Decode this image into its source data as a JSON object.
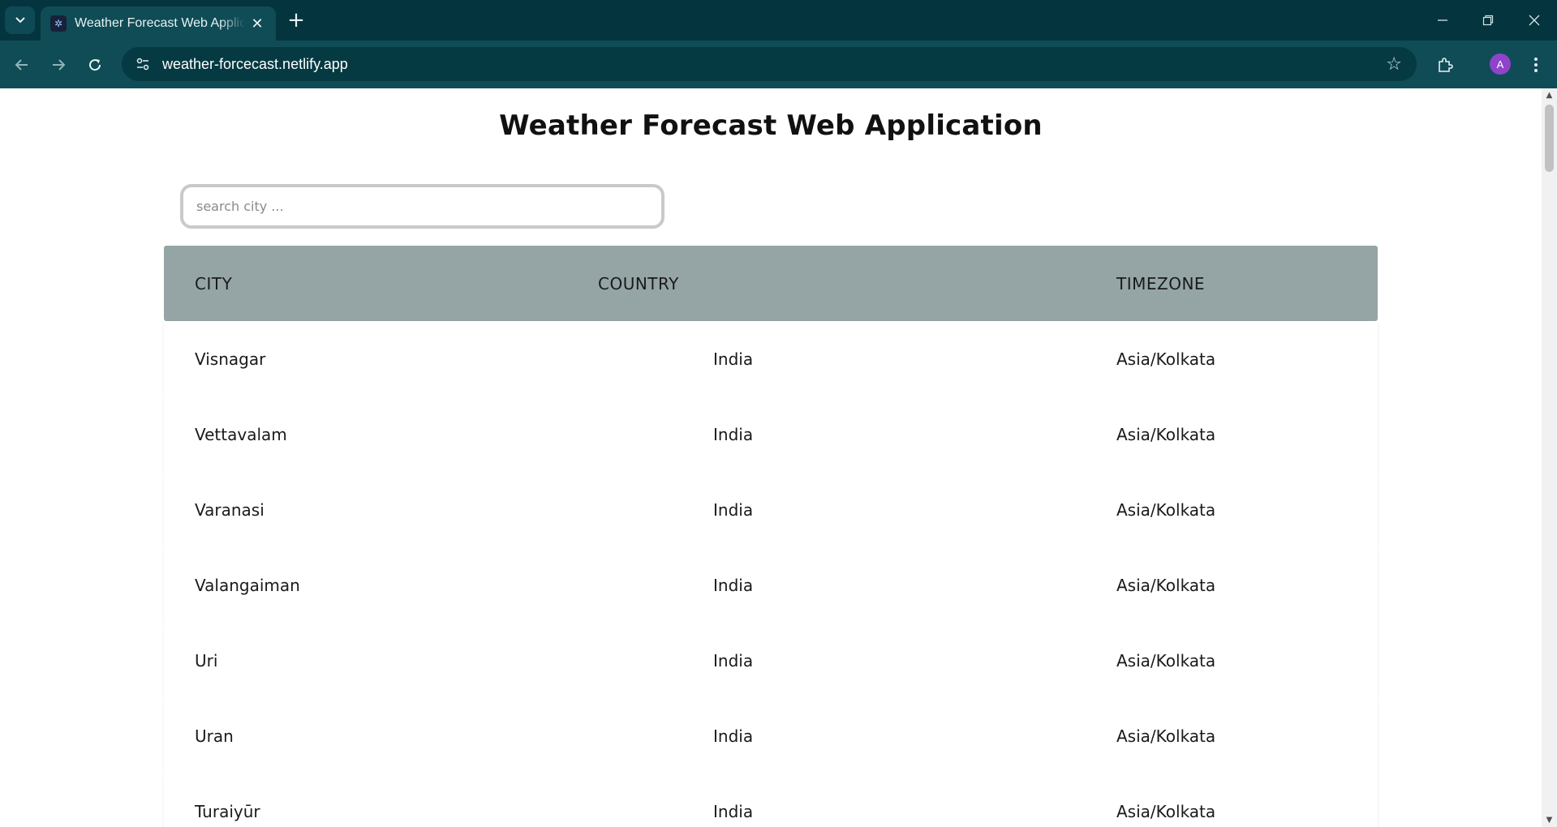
{
  "browser": {
    "tab_title": "Weather Forecast Web Application",
    "url": "weather-forcecast.netlify.app",
    "profile_initial": "A",
    "accent_color": "#04343d"
  },
  "page": {
    "title": "Weather Forecast Web Application",
    "search_placeholder": "search city ..."
  },
  "table": {
    "headers": {
      "city": "CITY",
      "country": "COUNTRY",
      "timezone": "TIMEZONE"
    },
    "header_color": "#95a5a6",
    "rows": [
      {
        "city": "Visnagar",
        "country": "India",
        "timezone": "Asia/Kolkata"
      },
      {
        "city": "Vettavalam",
        "country": "India",
        "timezone": "Asia/Kolkata"
      },
      {
        "city": "Varanasi",
        "country": "India",
        "timezone": "Asia/Kolkata"
      },
      {
        "city": "Valangaiman",
        "country": "India",
        "timezone": "Asia/Kolkata"
      },
      {
        "city": "Uri",
        "country": "India",
        "timezone": "Asia/Kolkata"
      },
      {
        "city": "Uran",
        "country": "India",
        "timezone": "Asia/Kolkata"
      },
      {
        "city": "Turaiyūr",
        "country": "India",
        "timezone": "Asia/Kolkata"
      }
    ]
  }
}
